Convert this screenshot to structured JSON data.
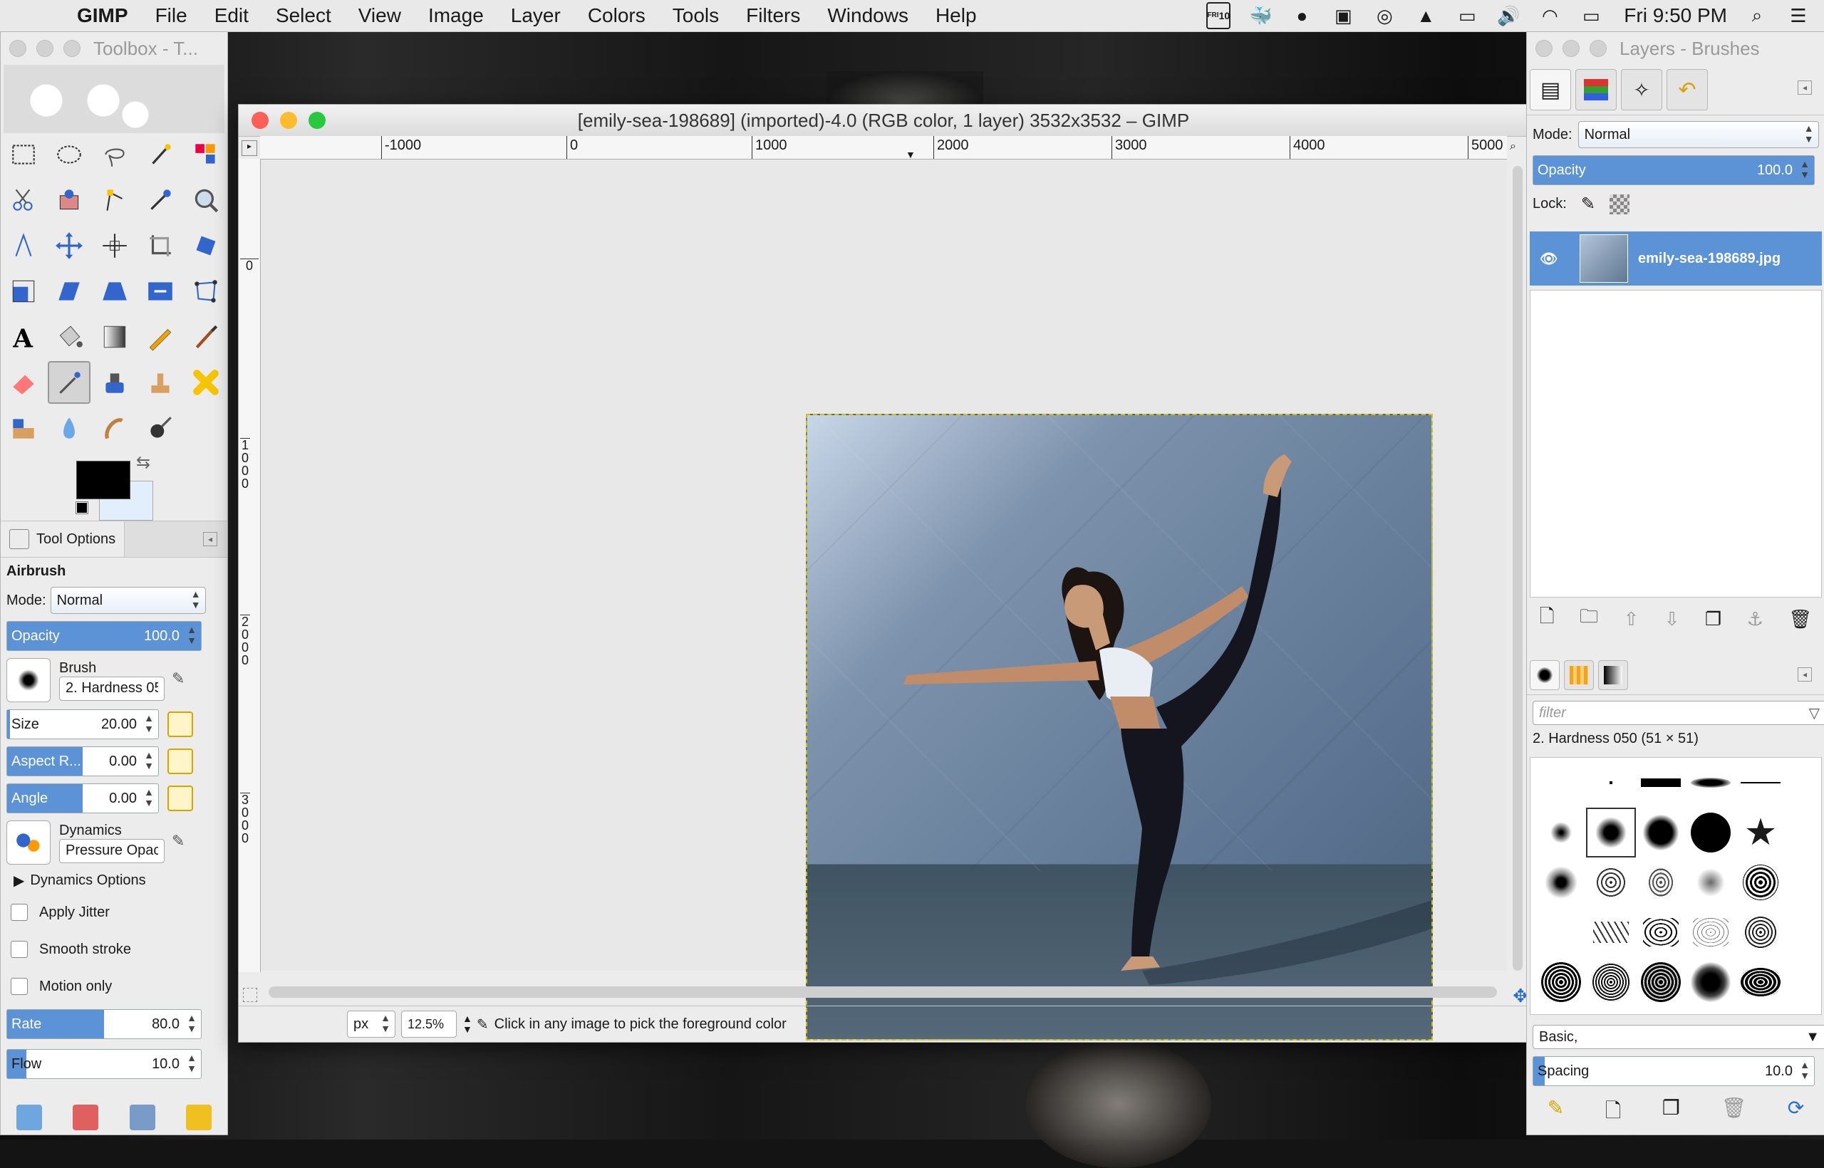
{
  "menubar": {
    "app_name": "GIMP",
    "menus": [
      "File",
      "Edit",
      "Select",
      "View",
      "Image",
      "Layer",
      "Colors",
      "Tools",
      "Filters",
      "Windows",
      "Help"
    ],
    "calendar_day": "10",
    "calendar_month": "FRI",
    "clock": "Fri 9:50 PM"
  },
  "toolbox": {
    "title": "Toolbox - T...",
    "tool_options_tab": "Tool Options",
    "tool_name": "Airbrush",
    "mode_label": "Mode:",
    "mode_value": "Normal",
    "opacity_label": "Opacity",
    "opacity_value": "100.0",
    "opacity_fraction": 1.0,
    "brush_label": "Brush",
    "brush_value": "2. Hardness 05",
    "size_label": "Size",
    "size_value": "20.00",
    "size_fraction": 0.02,
    "aspect_label": "Aspect R...",
    "aspect_value": "0.00",
    "aspect_fraction": 0.5,
    "angle_label": "Angle",
    "angle_value": "0.00",
    "angle_fraction": 0.5,
    "dynamics_label": "Dynamics",
    "dynamics_value": "Pressure Opac",
    "dynamics_options": "Dynamics Options",
    "apply_jitter": "Apply Jitter",
    "smooth_stroke": "Smooth stroke",
    "motion_only": "Motion only",
    "rate_label": "Rate",
    "rate_value": "80.0",
    "rate_fraction": 0.5,
    "flow_label": "Flow",
    "flow_value": "10.0",
    "flow_fraction": 0.1,
    "fg_color": "#000000",
    "bg_color": "#e2eefb"
  },
  "image_window": {
    "title": "[emily-sea-198689] (imported)-4.0 (RGB color, 1 layer) 3532x3532 – GIMP",
    "hruler_labels": [
      "-1000",
      "0",
      "1000",
      "2000",
      "3000",
      "4000",
      "5000"
    ],
    "vruler_labels": [
      "0",
      "1000",
      "2000",
      "3000"
    ],
    "unit": "px",
    "zoom": "12.5%",
    "status_message": "Click in any image to pick the foreground color"
  },
  "layers_panel": {
    "title": "Layers - Brushes",
    "mode_label": "Mode:",
    "mode_value": "Normal",
    "opacity_label": "Opacity",
    "opacity_value": "100.0",
    "opacity_fraction": 1.0,
    "lock_label": "Lock:",
    "layer_name": "emily-sea-198689.jpg",
    "brush_filter_placeholder": "filter",
    "brush_selected": "2. Hardness 050 (51 × 51)",
    "brush_tag": "Basic,",
    "spacing_label": "Spacing",
    "spacing_value": "10.0",
    "spacing_fraction": 0.04
  },
  "colors": {
    "accent": "#5b93d6",
    "close": "#fc5f57",
    "minimize": "#fdbc2e",
    "zoom": "#28c840"
  }
}
